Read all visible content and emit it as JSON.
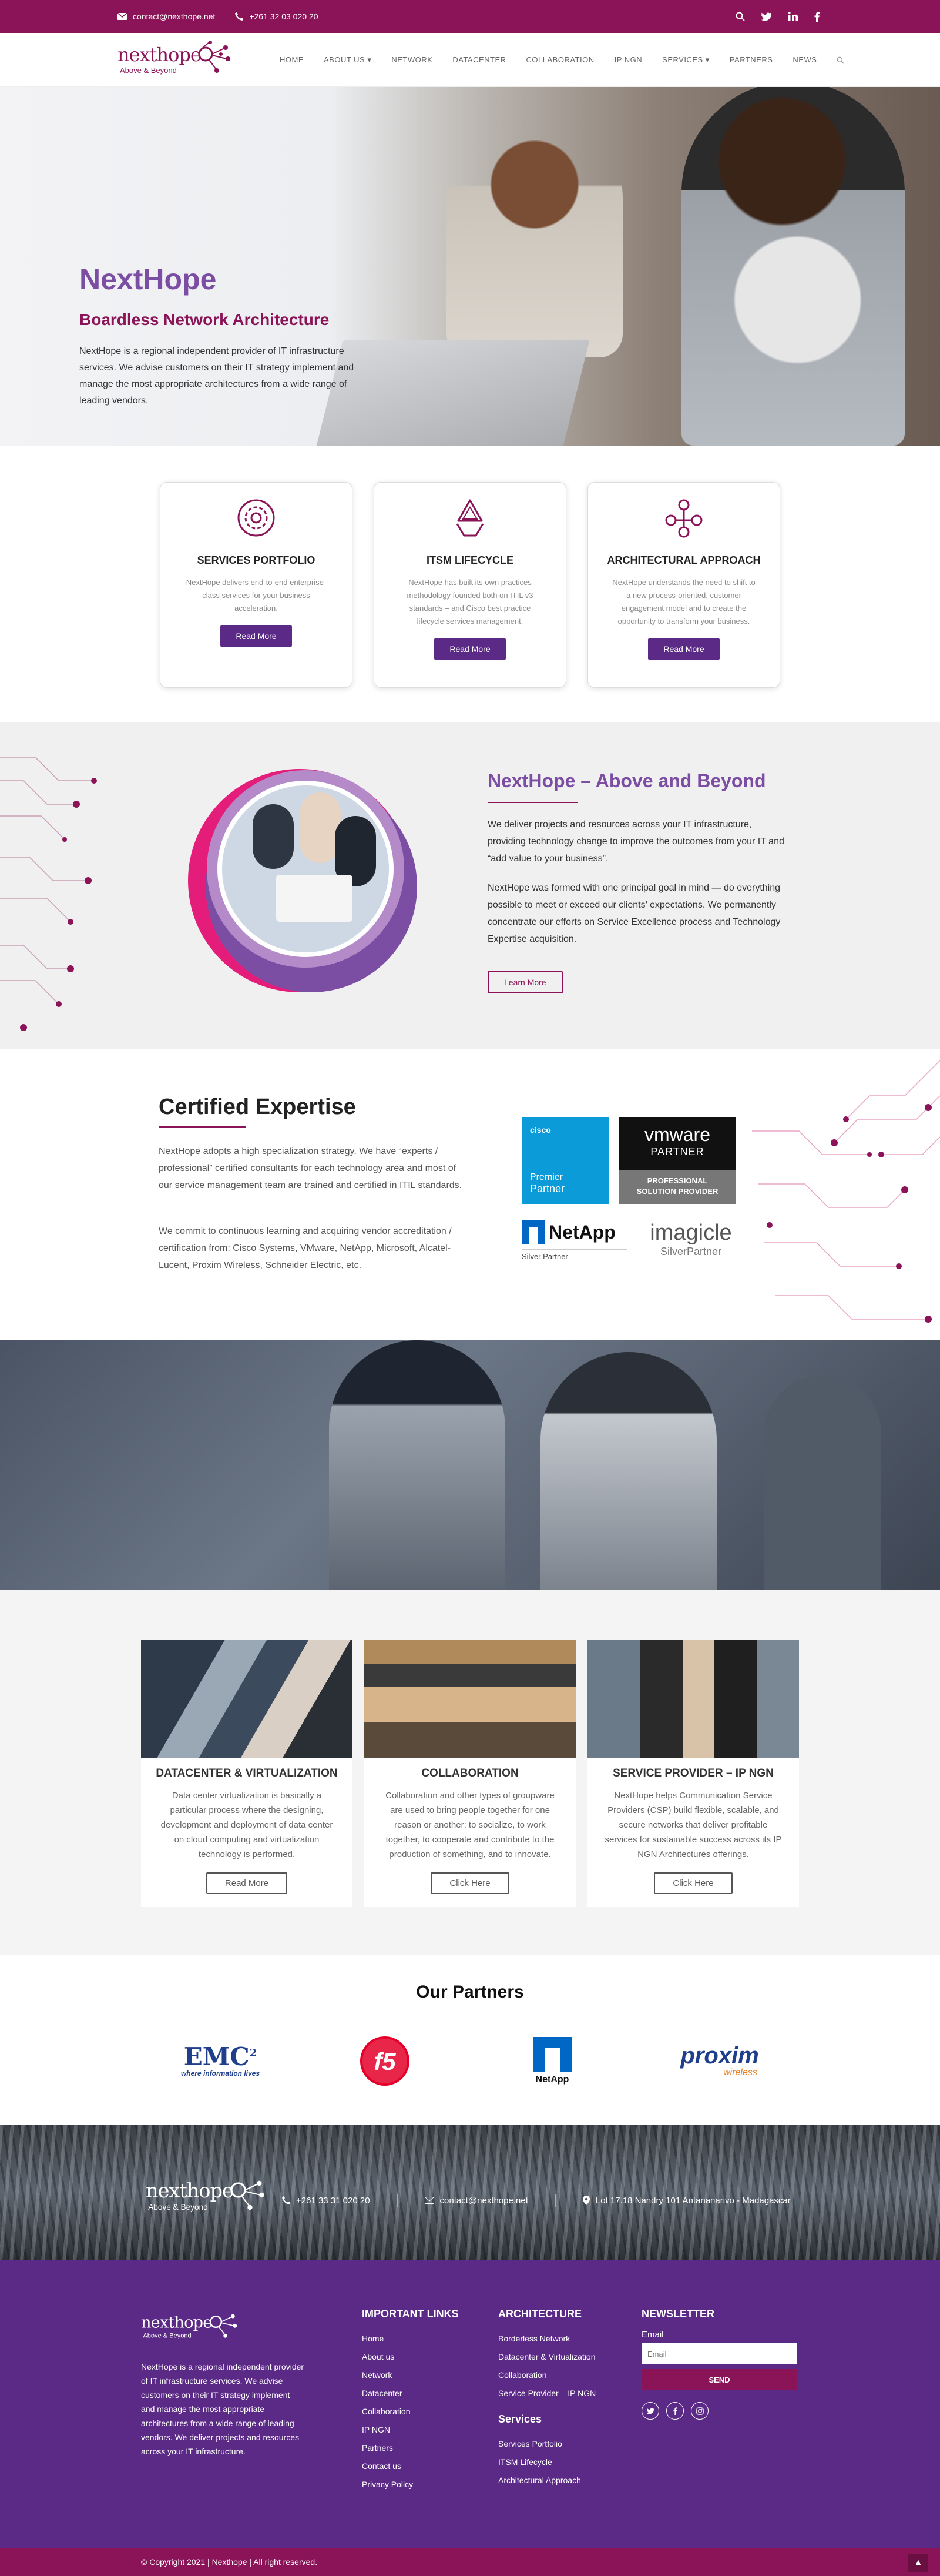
{
  "topbar": {
    "email": "contact@nexthope.net",
    "phone": "+261 32 03 020 20"
  },
  "brand": {
    "name": "nexthope",
    "tagline": "Above & Beyond",
    "color_primary": "#8a1457",
    "color_purple": "#5b2a86",
    "color_accent": "#7b4ea3"
  },
  "nav": {
    "items": [
      {
        "label": "Home"
      },
      {
        "label": "About us"
      },
      {
        "label": "Network"
      },
      {
        "label": "Datacenter"
      },
      {
        "label": "Collaboration"
      },
      {
        "label": "IP NGN"
      },
      {
        "label": "Services"
      },
      {
        "label": "Partners"
      },
      {
        "label": "News"
      }
    ]
  },
  "hero": {
    "title": "NextHope",
    "subtitle": "Boardless Network Architecture",
    "text": "NextHope is a regional independent provider of IT infrastructure services. We advise customers on their IT strategy implement and manage the most appropriate architectures from a wide range of leading vendors."
  },
  "services": [
    {
      "icon": "gear-network-icon",
      "title": "SERVICES PORTFOLIO",
      "text": "NextHope delivers end-to-end enterprise-class services for your business acceleration.",
      "button": "Read More"
    },
    {
      "icon": "recycle-icon",
      "title": "ITSM LIFECYCLE",
      "text": "NextHope has built its own practices methodology founded both on ITIL v3 standards – and Cisco best practice lifecycle services management.",
      "button": "Read More"
    },
    {
      "icon": "people-network-icon",
      "title": "ARCHITECTURAL APPROACH",
      "text": "NextHope understands the need to shift to a new process-oriented, customer engagement model and to create the opportunity to transform your business.",
      "button": "Read More"
    }
  ],
  "about": {
    "title": "NextHope – Above and Beyond",
    "p1": "We deliver projects and resources across your IT infrastructure, providing technology change to improve the outcomes from your IT and “add value to your business”.",
    "p2": "NextHope was formed with one principal goal in mind — do everything possible to meet or exceed our clients’ expectations. We permanently concentrate our efforts on Service Excellence process and Technology Expertise acquisition.",
    "button": "Learn More"
  },
  "certified": {
    "title": "Certified Expertise",
    "p1": "NextHope adopts a high specialization strategy. We have “experts / professional” certified consultants for each technology area and most of our service management team are trained and certified in ITIL standards.",
    "p2": "We commit to continuous learning and acquiring vendor accreditation / certification from: Cisco Systems, VMware, NetApp, Microsoft, Alcatel-Lucent, Proxim Wireless, Schneider Electric, etc.",
    "badges": {
      "cisco_name": "cisco",
      "cisco_l1": "Premier",
      "cisco_l2": "Partner",
      "vmware_name": "vmware",
      "vmware_l1": "PARTNER",
      "vmware_l2": "PROFESSIONAL",
      "vmware_l3": "SOLUTION PROVIDER",
      "netapp_name": "NetApp",
      "netapp_sub": "Silver Partner",
      "imagicle_name": "imagicle",
      "imagicle_sub": "SilverPartner"
    }
  },
  "solutions": [
    {
      "title": "Datacenter & Virtualization",
      "text": "Data center virtualization is basically a particular process where the designing, development and deployment of data center on cloud computing and virtualization technology is performed.",
      "button": "Read More"
    },
    {
      "title": "Collaboration",
      "text": "Collaboration and other types of groupware are used to bring people together for one reason or another: to socialize, to work together, to cooperate and contribute to the production of something, and to innovate.",
      "button": "Click Here"
    },
    {
      "title": "Service Provider – IP NGN",
      "text": "NextHope helps Communication Service Providers (CSP) build flexible, scalable, and secure networks that deliver profitable services for sustainable success across its IP NGN Architectures offerings.",
      "button": "Click Here"
    }
  ],
  "partners": {
    "title": "Our Partners",
    "emc_name": "EMC",
    "emc_sup": "2",
    "emc_sub": "where information lives",
    "f5_name": "f5",
    "netapp_name": "NetApp",
    "proxim_name": "proxim",
    "proxim_sub": "wireless"
  },
  "contact": {
    "phone": "+261 33 31 020 20",
    "email": "contact@nexthope.net",
    "address": "Lot 17.18 Nandry 101 Antananarivo - Madagascar"
  },
  "footer": {
    "about": "NextHope is a regional independent provider of IT infrastructure services. We advise customers on their IT strategy implement and manage the most appropriate architectures from a wide range of leading vendors. We deliver projects and resources across your IT infrastructure.",
    "links_title": "IMPORTANT LINKS",
    "links": [
      "Home",
      "About us",
      "Network",
      "Datacenter",
      "Collaboration",
      "IP NGN",
      "Partners",
      "Contact us",
      "Privacy Policy"
    ],
    "arch_title": "ARCHITECTURE",
    "arch": [
      "Borderless Network",
      "Datacenter & Virtualization",
      "Collaboration",
      "Service Provider – IP NGN"
    ],
    "services_title": "Services",
    "services": [
      "Services Portfolio",
      "ITSM Lifecycle",
      "Architectural Approach"
    ],
    "newsletter_title": "NEWSLETTER",
    "email_label": "Email",
    "email_placeholder": "Email",
    "send": "SEND"
  },
  "copyright": "© Copyright 2021 | Nexthope | All right reserved."
}
